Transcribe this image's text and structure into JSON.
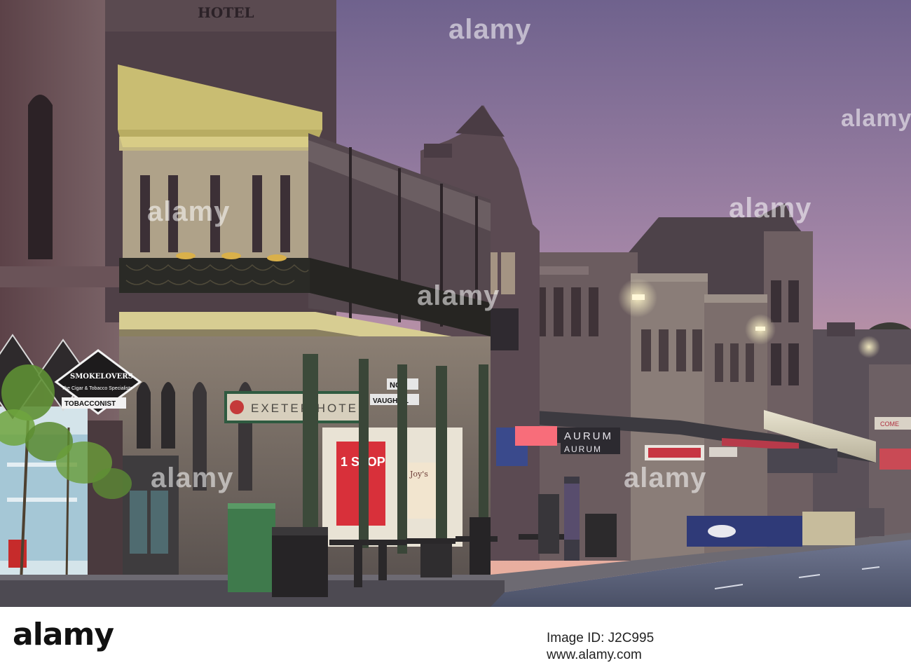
{
  "scene": {
    "signs": {
      "hotel_top": "HOTEL",
      "exeter": "EXETER HOTEL",
      "street_top": "NO",
      "street_bottom": "VAUGH PL",
      "smokeless_top": "SMOKELOVERS",
      "smokeless_sub": "The Cigar & Tobacco Specialists",
      "tobacconist": "TOBACCONIST",
      "aurum_1": "AURUM",
      "aurum_2": "AURUM",
      "shop_sign_1": "1 STOP",
      "shop_sign_2": "Joy's",
      "far_sign": "COME"
    },
    "colors": {
      "sky_top": "#7c6a93",
      "sky_mid": "#b48aa8",
      "sky_bottom": "#e7a99c",
      "building_dark": "#4a3c44",
      "building_mid": "#7a6668",
      "balcony_light": "#d8cf8f",
      "road": "#5d6478",
      "sidewalk": "#6e6a70",
      "neon_red": "#e54050",
      "window_glow": "#f3e2b0"
    }
  },
  "watermark": {
    "text": "alamy"
  },
  "footer": {
    "logo": "alamy",
    "image_id": "Image ID: J2C995",
    "url": "www.alamy.com"
  }
}
